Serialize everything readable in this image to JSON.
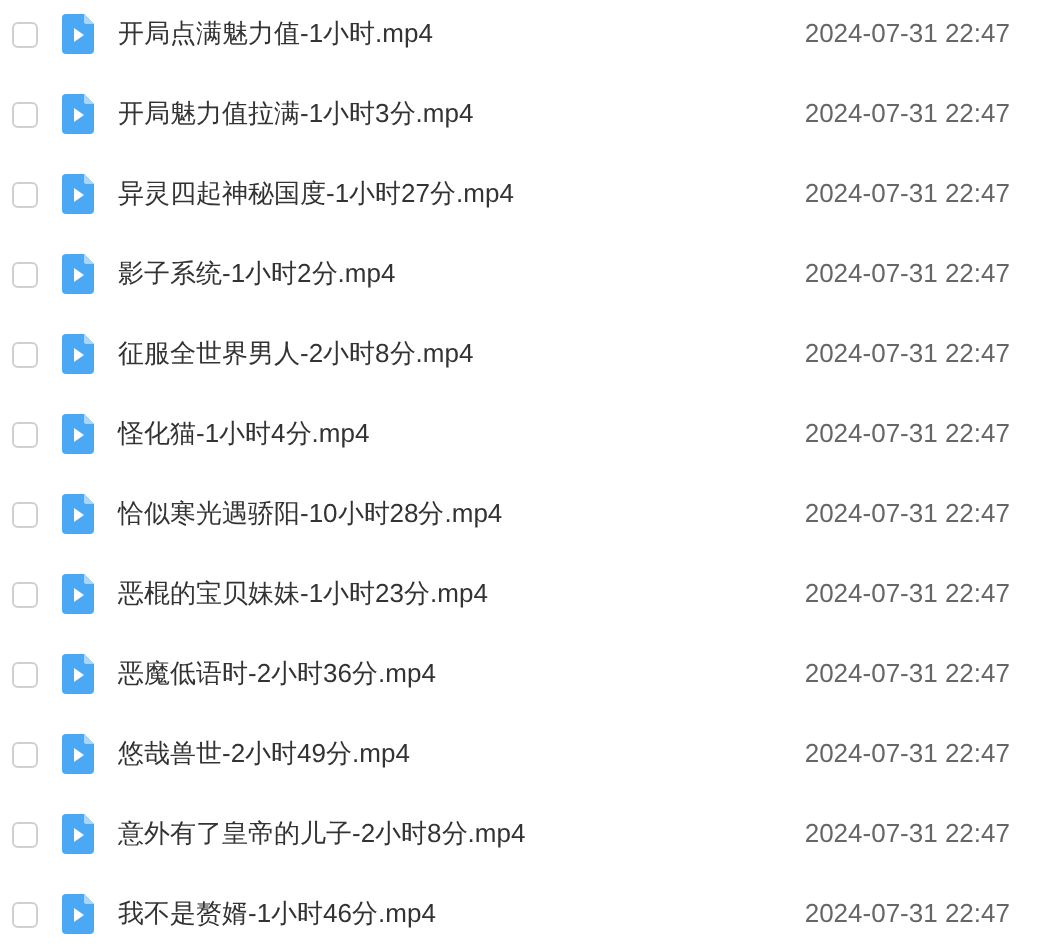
{
  "files": [
    {
      "name": "开局点满魅力值-1小时.mp4",
      "date": "2024-07-31 22:47",
      "checked": false
    },
    {
      "name": "开局魅力值拉满-1小时3分.mp4",
      "date": "2024-07-31 22:47",
      "checked": false
    },
    {
      "name": "异灵四起神秘国度-1小时27分.mp4",
      "date": "2024-07-31 22:47",
      "checked": false
    },
    {
      "name": "影子系统-1小时2分.mp4",
      "date": "2024-07-31 22:47",
      "checked": false
    },
    {
      "name": "征服全世界男人-2小时8分.mp4",
      "date": "2024-07-31 22:47",
      "checked": false
    },
    {
      "name": "怪化猫-1小时4分.mp4",
      "date": "2024-07-31 22:47",
      "checked": false
    },
    {
      "name": "恰似寒光遇骄阳-10小时28分.mp4",
      "date": "2024-07-31 22:47",
      "checked": false
    },
    {
      "name": "恶棍的宝贝妹妹-1小时23分.mp4",
      "date": "2024-07-31 22:47",
      "checked": false
    },
    {
      "name": "恶魔低语时-2小时36分.mp4",
      "date": "2024-07-31 22:47",
      "checked": false
    },
    {
      "name": "悠哉兽世-2小时49分.mp4",
      "date": "2024-07-31 22:47",
      "checked": false
    },
    {
      "name": "意外有了皇帝的儿子-2小时8分.mp4",
      "date": "2024-07-31 22:47",
      "checked": false
    },
    {
      "name": "我不是赘婿-1小时46分.mp4",
      "date": "2024-07-31 22:47",
      "checked": false
    }
  ]
}
